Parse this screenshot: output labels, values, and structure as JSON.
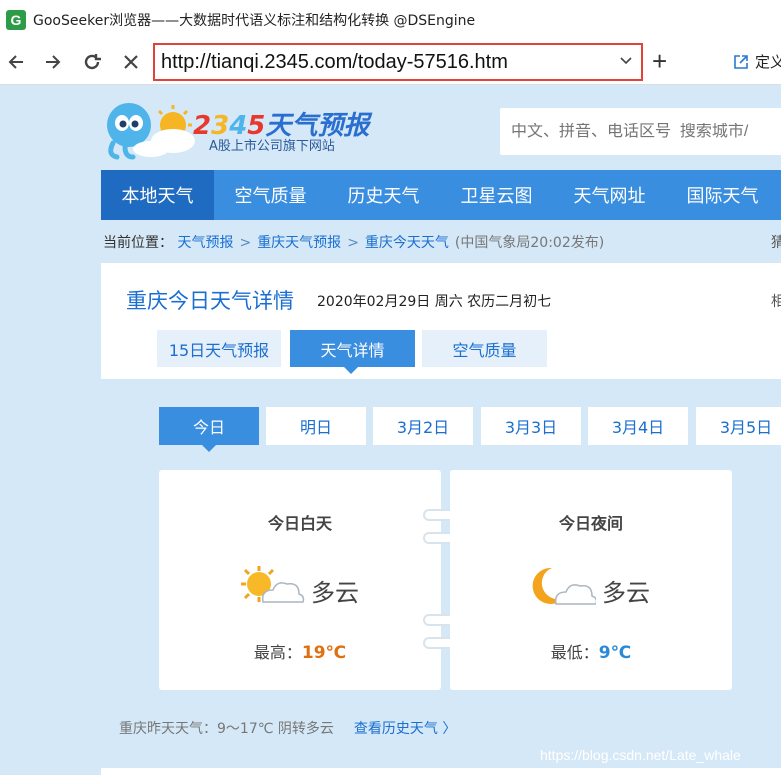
{
  "window": {
    "app_icon_letter": "G",
    "title": "GooSeeker浏览器——大数据时代语义标注和结构化转换 @DSEngine"
  },
  "toolbar": {
    "url": "http://tianqi.2345.com/today-57516.htm",
    "new_tab_label": "+",
    "ext_label": "定义"
  },
  "header": {
    "logo_text": "2345天气预报",
    "logo_sub": "A股上市公司旗下网站",
    "search_placeholder": "中文、拼音、电话区号  搜索城市/"
  },
  "nav": {
    "items": [
      {
        "label": "本地天气",
        "active": true
      },
      {
        "label": "空气质量"
      },
      {
        "label": "历史天气"
      },
      {
        "label": "卫星云图"
      },
      {
        "label": "天气网址"
      },
      {
        "label": "国际天气"
      }
    ]
  },
  "breadcrumb": {
    "prefix": "当前位置：",
    "items": [
      "天气预报",
      "重庆天气预报",
      "重庆今天天气"
    ],
    "note": "(中国气象局20:02发布)",
    "right": "猜"
  },
  "detail": {
    "title": "重庆今日天气详情",
    "date": "2020年02月29日  周六  农历二月初七",
    "right": "相",
    "tabs": [
      {
        "label": "15日天气预报"
      },
      {
        "label": "天气详情",
        "active": true
      },
      {
        "label": "空气质量"
      }
    ]
  },
  "days": [
    "今日",
    "明日",
    "3月2日",
    "3月3日",
    "3月4日",
    "3月5日"
  ],
  "day_card": {
    "heading": "今日白天",
    "icon": "sun-cloud-icon",
    "condition": "多云",
    "temp_label": "最高：",
    "temp_value": "19℃",
    "temp_color": "#e0700f"
  },
  "night_card": {
    "heading": "今日夜间",
    "icon": "moon-cloud-icon",
    "condition": "多云",
    "temp_label": "最低：",
    "temp_value": "9℃",
    "temp_color": "#2a8ad8"
  },
  "footer": {
    "yesterday": "重庆昨天天气：9～17℃  阴转多云",
    "history_link": "查看历史天气 〉"
  },
  "watermark": "https://blog.csdn.net/Late_whale",
  "colors": {
    "accent": "#3a8ee0",
    "nav_active": "#1f6bc2",
    "page_bg": "#d5e8f7",
    "url_border": "#e0433a"
  }
}
